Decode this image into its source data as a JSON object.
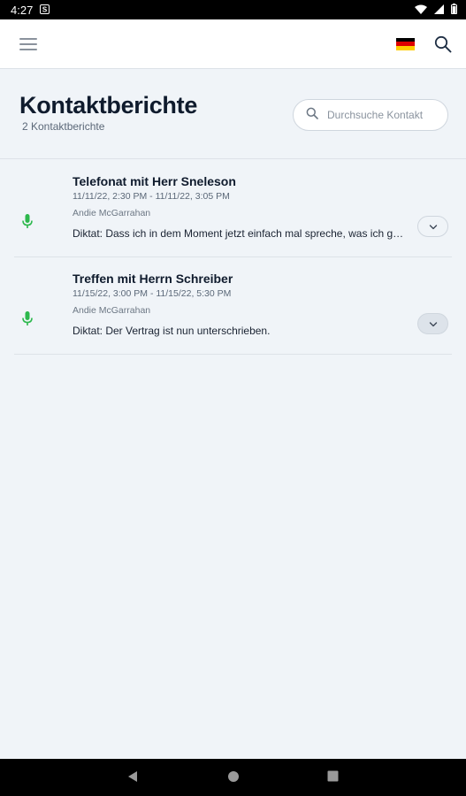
{
  "status_bar": {
    "time": "4:27"
  },
  "header": {
    "title": "Kontaktberichte",
    "subtitle": "2 Kontaktberichte",
    "search_placeholder": "Durchsuche Kontakt"
  },
  "colors": {
    "accent_green": "#2db84d",
    "title": "#0f1b2d",
    "background": "#f0f4f8"
  },
  "items": [
    {
      "title": "Telefonat mit Herr Sneleson",
      "date": "11/11/22, 2:30 PM - 11/11/22, 3:05 PM",
      "author": "Andie McGarrahan",
      "text": "Diktat: Dass ich in dem Moment jetzt einfach mal spreche, was ich gerade denke.",
      "icon": "microphone-icon"
    },
    {
      "title": "Treffen mit Herrn Schreiber",
      "date": "11/15/22, 3:00 PM - 11/15/22, 5:30 PM",
      "author": "Andie McGarrahan",
      "text": "Diktat: Der Vertrag ist nun unterschrieben.",
      "icon": "microphone-icon"
    }
  ]
}
